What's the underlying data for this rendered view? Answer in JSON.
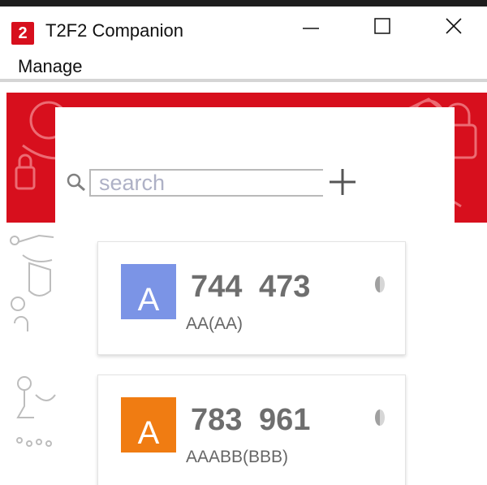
{
  "window": {
    "title": "T2F2 Companion",
    "icon_glyph": "2",
    "accent_color": "#d70f1d"
  },
  "menu": {
    "items": [
      {
        "label": "Manage"
      }
    ]
  },
  "search": {
    "placeholder": "search",
    "value": ""
  },
  "accounts": [
    {
      "avatar_letter": "A",
      "avatar_color": "#7b94e6",
      "code": "744 473",
      "name": "AA(AA)",
      "icon": "timer-icon"
    },
    {
      "avatar_letter": "A",
      "avatar_color": "#f07c12",
      "code": "783 961",
      "name": "AAABB(BBB)",
      "icon": "timer-icon"
    }
  ]
}
